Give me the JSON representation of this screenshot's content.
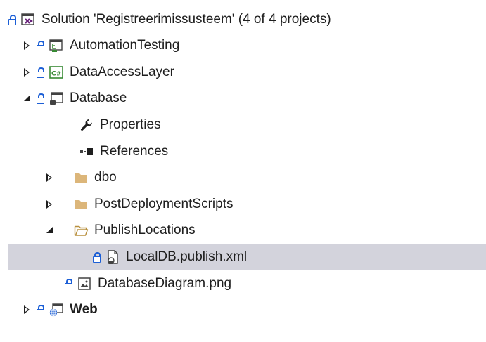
{
  "explorer": {
    "items": [
      {
        "label": "Solution 'Registreerimissusteem' (4 of 4 projects)",
        "icon": "solution-icon",
        "level": 0,
        "expander": "none",
        "locked": true,
        "bold": false,
        "selected": false
      },
      {
        "label": "AutomationTesting",
        "icon": "test-project-icon",
        "level": 1,
        "expander": "collapsed",
        "locked": true,
        "bold": false,
        "selected": false
      },
      {
        "label": "DataAccessLayer",
        "icon": "csharp-project-icon",
        "level": 1,
        "expander": "collapsed",
        "locked": true,
        "bold": false,
        "selected": false
      },
      {
        "label": "Database",
        "icon": "database-project-icon",
        "level": 1,
        "expander": "expanded",
        "locked": true,
        "bold": false,
        "selected": false
      },
      {
        "label": "Properties",
        "icon": "wrench-icon",
        "level": 2,
        "expander": "none",
        "locked": false,
        "bold": false,
        "selected": false
      },
      {
        "label": "References",
        "icon": "references-icon",
        "level": 2,
        "expander": "none",
        "locked": false,
        "bold": false,
        "selected": false
      },
      {
        "label": "dbo",
        "icon": "folder-icon",
        "level": 2,
        "expander": "collapsed",
        "locked": false,
        "bold": false,
        "selected": false
      },
      {
        "label": "PostDeploymentScripts",
        "icon": "folder-icon",
        "level": 2,
        "expander": "collapsed",
        "locked": false,
        "bold": false,
        "selected": false
      },
      {
        "label": "PublishLocations",
        "icon": "folder-open-icon",
        "level": 2,
        "expander": "expanded",
        "locked": false,
        "bold": false,
        "selected": false
      },
      {
        "label": "LocalDB.publish.xml",
        "icon": "publish-file-icon",
        "level": 3,
        "expander": "none",
        "locked": true,
        "bold": false,
        "selected": true
      },
      {
        "label": "DatabaseDiagram.png",
        "icon": "image-file-icon",
        "level": 2,
        "expander": "none",
        "locked": true,
        "bold": false,
        "selected": false
      },
      {
        "label": "Web",
        "icon": "web-project-icon",
        "level": 1,
        "expander": "collapsed",
        "locked": true,
        "bold": true,
        "selected": false
      }
    ]
  },
  "colors": {
    "selection": "#d3d3dc",
    "lock": "#1c5fd6",
    "folder": "#dcb67a",
    "text": "#1e1e1e"
  }
}
